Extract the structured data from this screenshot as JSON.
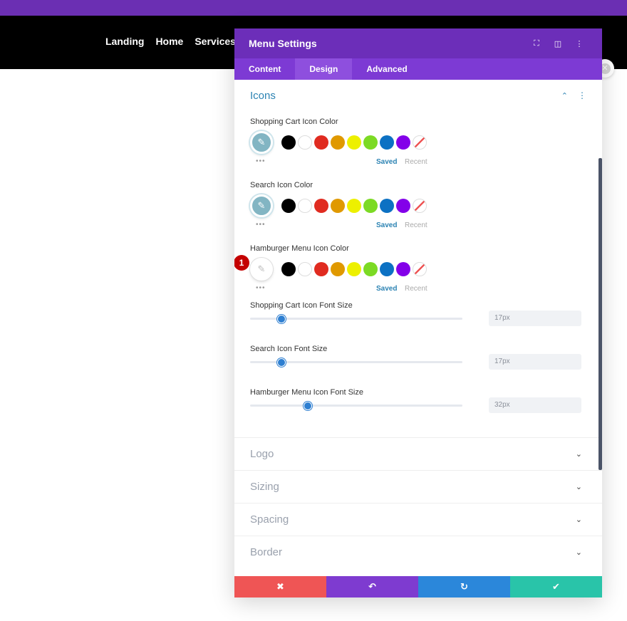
{
  "nav": {
    "items": [
      "Landing",
      "Home",
      "Services"
    ]
  },
  "panel": {
    "title": "Menu Settings",
    "header_icons": [
      "focus-icon",
      "split-view-icon",
      "more-vertical-icon"
    ],
    "tabs": [
      {
        "label": "Content",
        "active": false
      },
      {
        "label": "Design",
        "active": true
      },
      {
        "label": "Advanced",
        "active": false
      }
    ]
  },
  "icons_section": {
    "title": "Icons",
    "color_fields": [
      {
        "label": "Shopping Cart Icon Color",
        "picker_color": "#82b5c3",
        "saved": "Saved",
        "recent": "Recent"
      },
      {
        "label": "Search Icon Color",
        "picker_color": "#82b5c3",
        "saved": "Saved",
        "recent": "Recent"
      },
      {
        "label": "Hamburger Menu Icon Color",
        "picker_color": "#ffffff",
        "saved": "Saved",
        "recent": "Recent",
        "badge": "1"
      }
    ],
    "swatches": [
      "#000000",
      "#ffffff",
      "#e02b20",
      "#e09900",
      "#edf000",
      "#7cda24",
      "#0c71c3",
      "#8300e9",
      "none"
    ],
    "sliders": [
      {
        "label": "Shopping Cart Icon Font Size",
        "value": "17px",
        "level": 0.148
      },
      {
        "label": "Search Icon Font Size",
        "value": "17px",
        "level": 0.148
      },
      {
        "label": "Hamburger Menu Icon Font Size",
        "value": "32px",
        "level": 0.272
      }
    ]
  },
  "collapsed_sections": [
    "Logo",
    "Sizing",
    "Spacing",
    "Border"
  ],
  "footer": {
    "buttons": [
      {
        "name": "discard-button",
        "icon": "✖",
        "color": "#ef5555"
      },
      {
        "name": "undo-button",
        "icon": "↶",
        "color": "#7e3bd0"
      },
      {
        "name": "redo-button",
        "icon": "↻",
        "color": "#2b87da"
      },
      {
        "name": "save-button",
        "icon": "✔",
        "color": "#29c4a9"
      }
    ]
  },
  "colors": {
    "accent": "#2c83b3",
    "header": "#6c2eb9",
    "tabs": "#7d3ad4"
  }
}
